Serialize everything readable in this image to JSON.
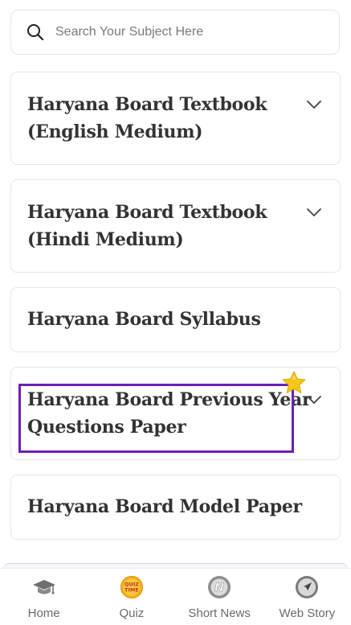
{
  "search": {
    "placeholder": "Search Your Subject Here"
  },
  "cards": [
    {
      "line1": "Haryana Board Textbook",
      "line2": "(English Medium)",
      "has_chevron": true
    },
    {
      "line1": "Haryana Board Textbook",
      "line2": "(Hindi Medium)",
      "has_chevron": true
    },
    {
      "line1": "Haryana Board Syllabus",
      "has_chevron": false
    },
    {
      "line1": "Haryana Board Previous Year",
      "line2": "Questions Paper",
      "has_chevron": true,
      "highlighted": true
    },
    {
      "line1": "Haryana Board Model Paper",
      "has_chevron": false
    }
  ],
  "bottom_nav": {
    "items": [
      {
        "label": "Home",
        "icon": "graduation-cap-icon"
      },
      {
        "label": "Quiz",
        "icon": "quiz-time-icon",
        "icon_text": "QUIZ TIME"
      },
      {
        "label": "Short News",
        "icon": "news-n-icon",
        "icon_text": "N"
      },
      {
        "label": "Web Story",
        "icon": "paper-plane-icon"
      }
    ]
  },
  "colors": {
    "highlight_border": "#6a1fb8",
    "title_text": "#333333",
    "card_border": "#e6e6e6",
    "star": "#f5c518"
  }
}
